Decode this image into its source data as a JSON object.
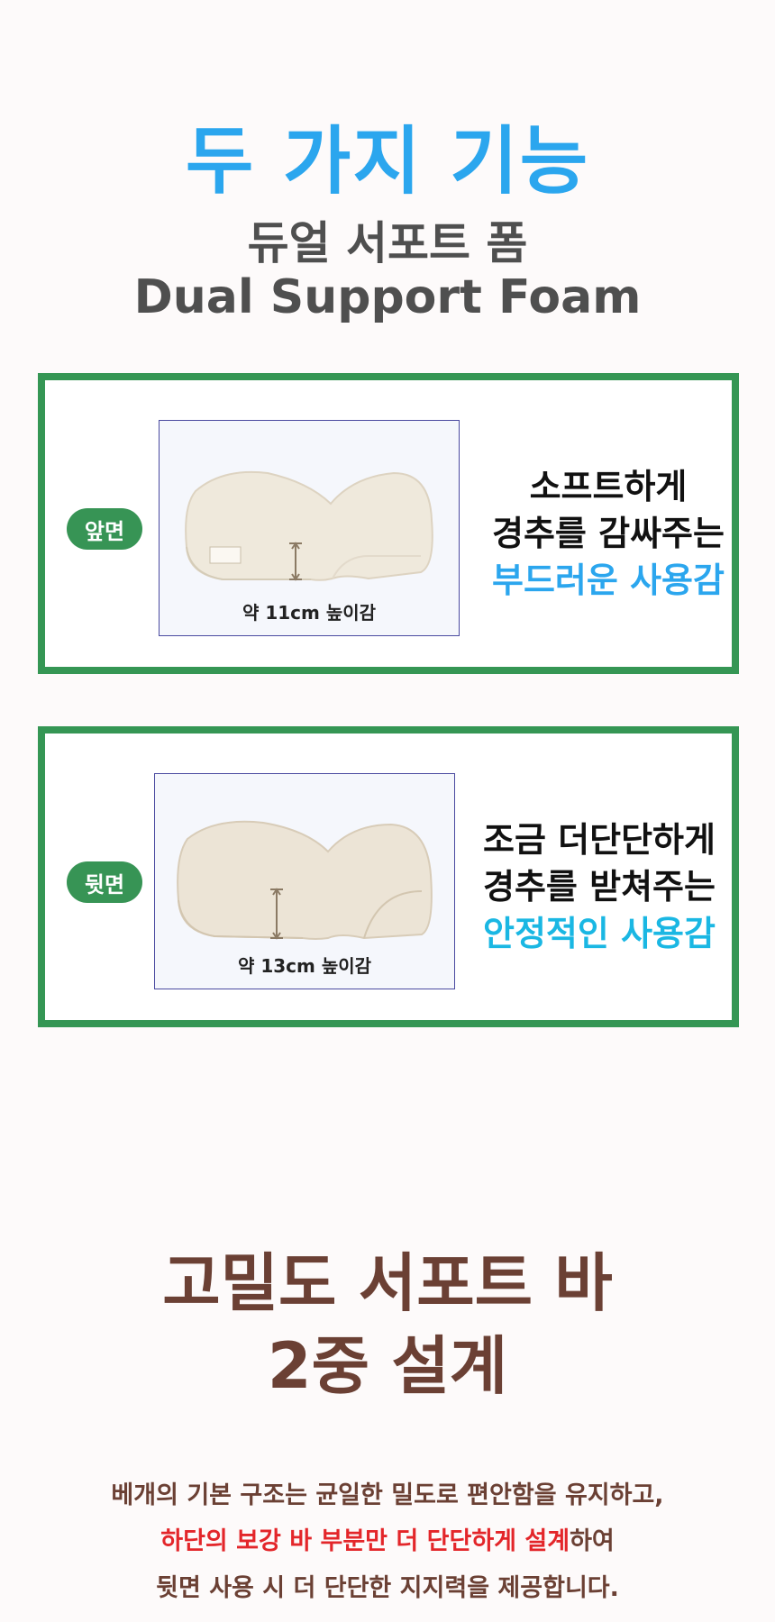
{
  "header": {
    "title": "두 가지 기능",
    "subtitle_ko": "듀얼 서포트 폼",
    "subtitle_en": "Dual Support Foam"
  },
  "cards": [
    {
      "badge": "앞면",
      "caption": "약 11cm 높이감",
      "lines": [
        "소프트하게",
        "경추를 감싸주는"
      ],
      "accent": "부드러운 사용감"
    },
    {
      "badge": "뒷면",
      "caption": "약 13cm 높이감",
      "lines": [
        "조금 더단단하게",
        "경추를 받쳐주는"
      ],
      "accent": "안정적인 사용감"
    }
  ],
  "support": {
    "title_line1": "고밀도 서포트 바",
    "title_line2": "2중 설계",
    "p1": "베개의 기본 구조는 균일한 밀도로 편안함을 유지하고,",
    "p2_red": "하단의 보강 바 부분만 더 단단하게 설계",
    "p2_rest": "하여",
    "p3": "뒷면 사용 시 더 단단한 지지력을 제공합니다."
  },
  "colors": {
    "title_blue": "#2ba6ee",
    "accent_cyan": "#1ab7e3",
    "frame_green": "#359654",
    "brown": "#6b4034",
    "red": "#e3262a"
  }
}
